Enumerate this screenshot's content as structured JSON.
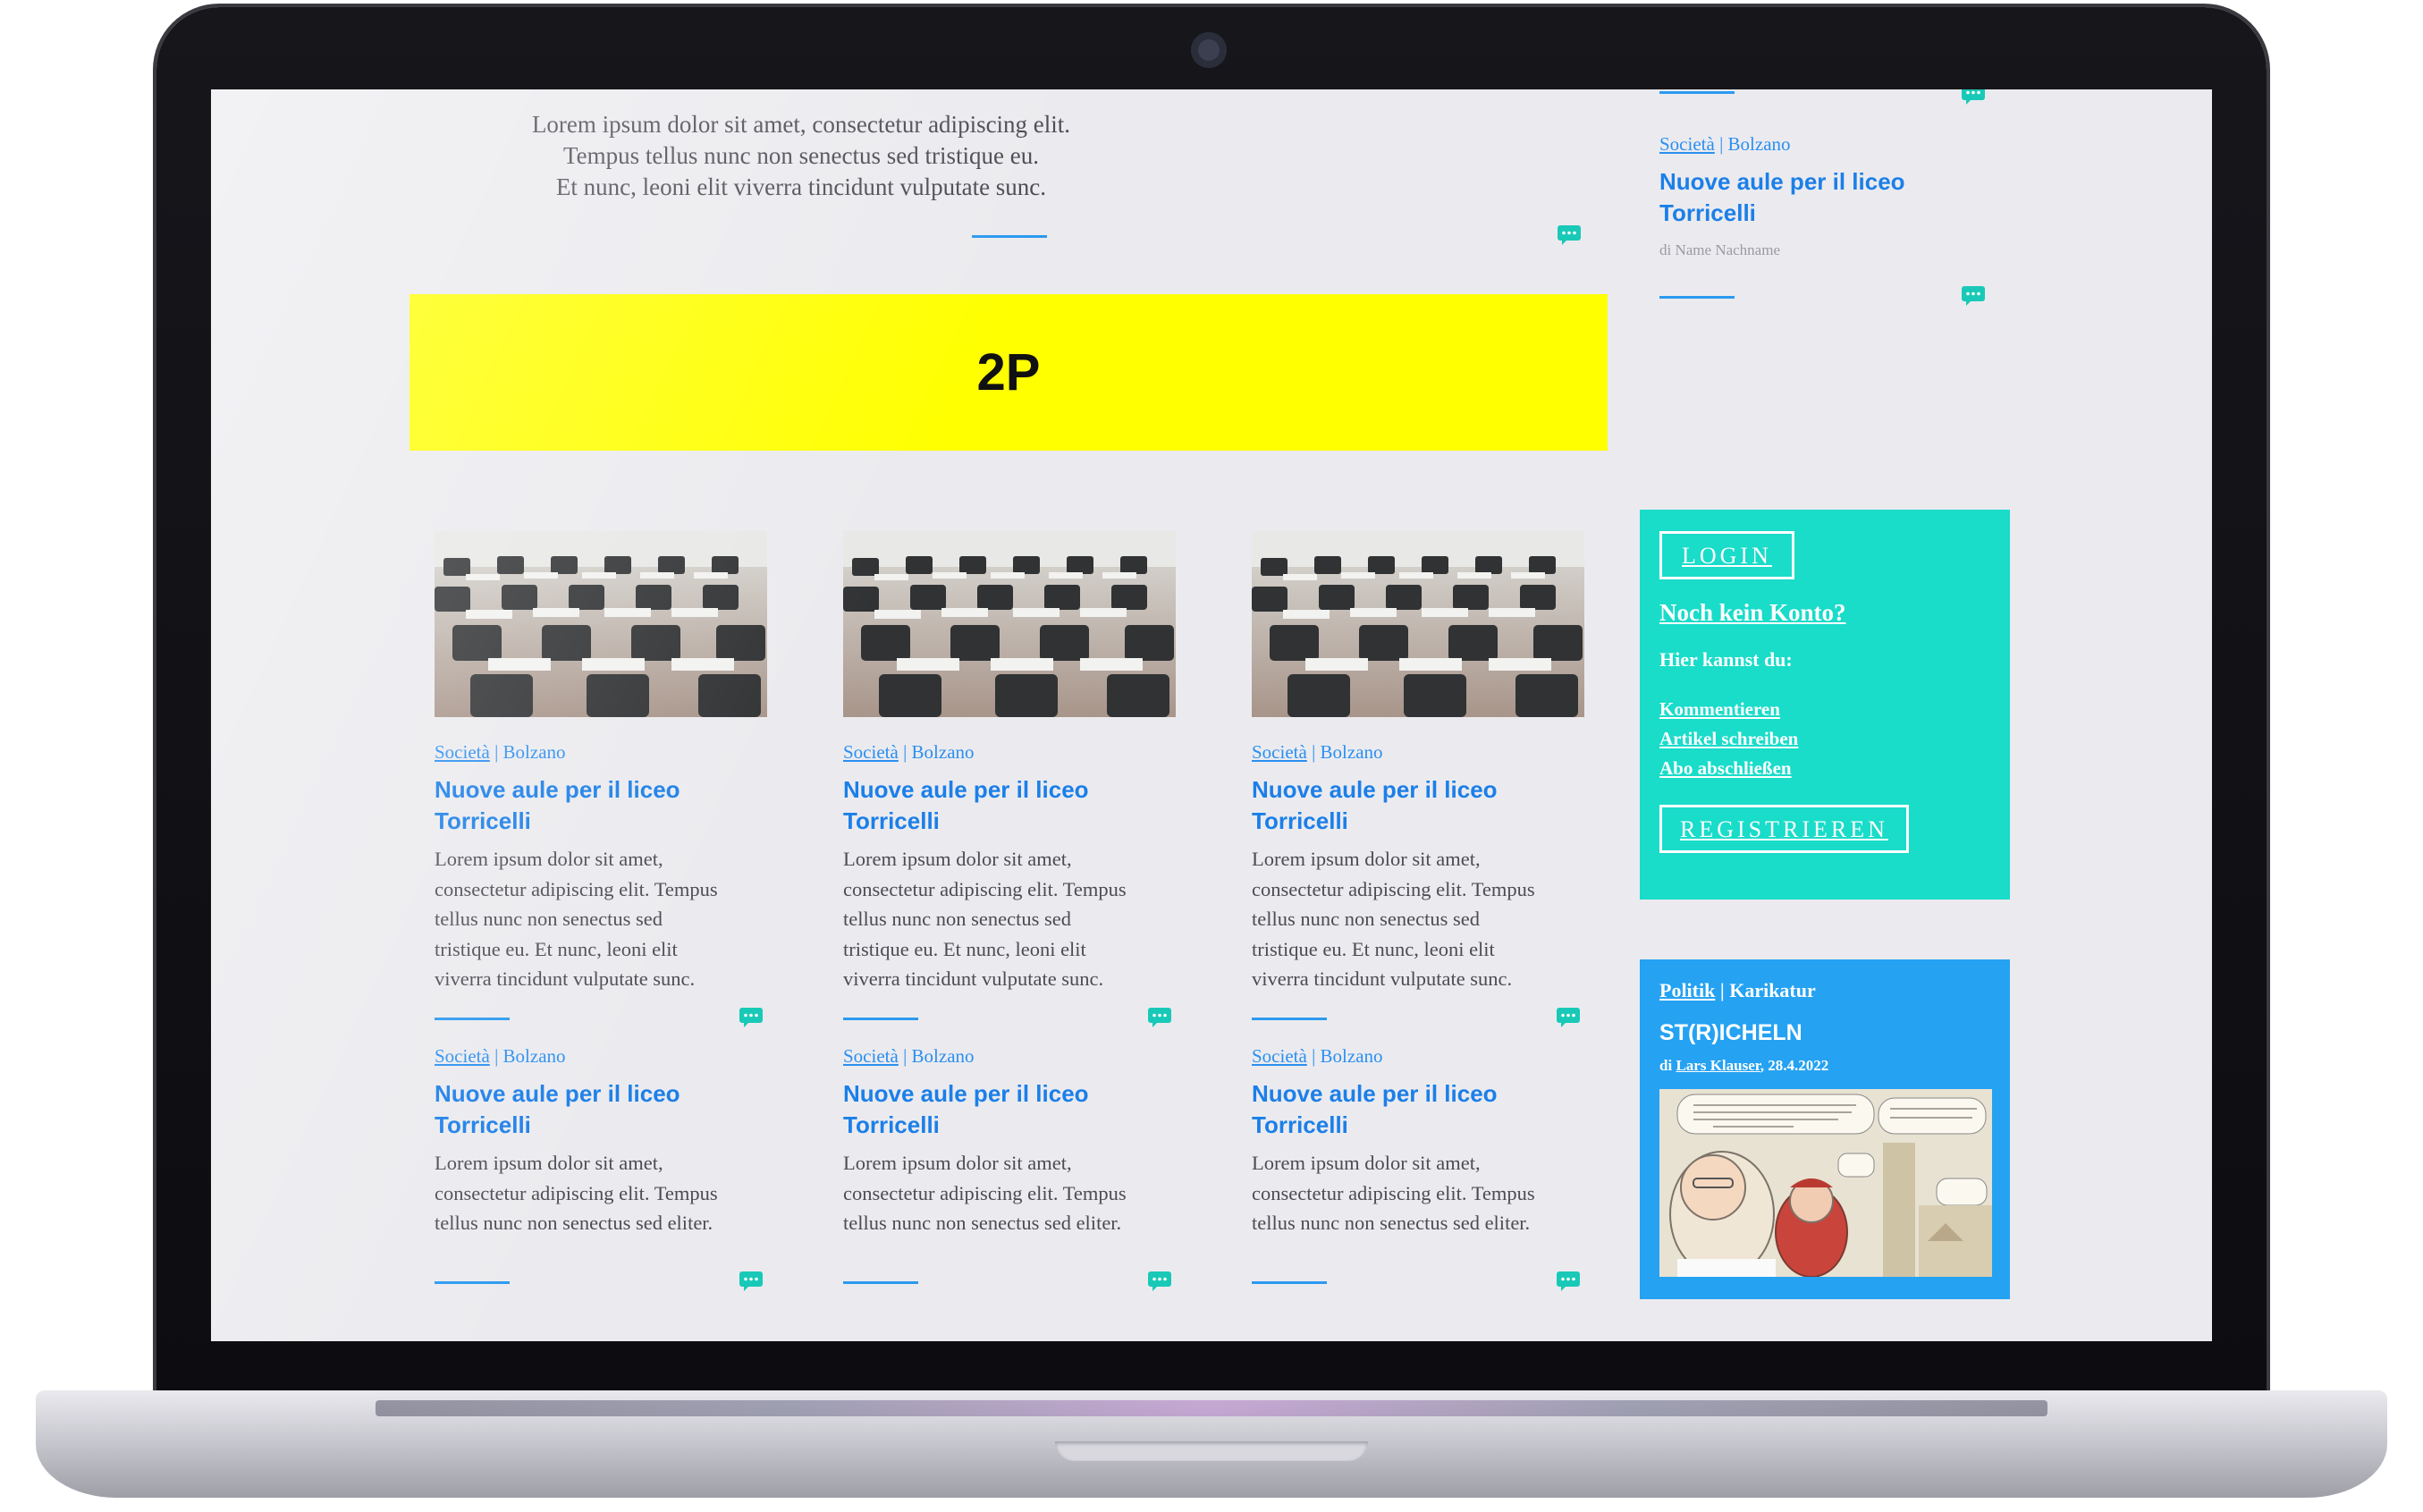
{
  "intro": {
    "lines": [
      "Lorem ipsum dolor sit amet, consectetur adipiscing elit.",
      "Tempus tellus nunc non senectus sed tristique eu.",
      "Et nunc, leoni elit viverra tincidunt vulputate sunc."
    ]
  },
  "ad": {
    "label": "2P"
  },
  "sidebar_top": {
    "category": "Società",
    "location": "Bolzano",
    "separator": " | ",
    "headline_line1": "Nuove aule per il liceo",
    "headline_line2": "Torricelli",
    "byline": "di Name Nachname"
  },
  "cards_top": [
    {
      "category": "Società",
      "separator": " | ",
      "location": "Bolzano",
      "headline_line1": "Nuove aule per il liceo",
      "headline_line2": "Torricelli",
      "body": [
        "Lorem ipsum dolor sit amet,",
        "consectetur adipiscing elit. Tempus",
        "tellus nunc non senectus sed",
        "tristique eu. Et nunc, leoni elit",
        "viverra tincidunt vulputate sunc."
      ]
    },
    {
      "category": "Società",
      "separator": " | ",
      "location": "Bolzano",
      "headline_line1": "Nuove aule per il liceo",
      "headline_line2": "Torricelli",
      "body": [
        "Lorem ipsum dolor sit amet,",
        "consectetur adipiscing elit. Tempus",
        "tellus nunc non senectus sed",
        "tristique eu. Et nunc, leoni elit",
        "viverra tincidunt vulputate sunc."
      ]
    },
    {
      "category": "Società",
      "separator": " | ",
      "location": "Bolzano",
      "headline_line1": "Nuove aule per il liceo",
      "headline_line2": "Torricelli",
      "body": [
        "Lorem ipsum dolor sit amet,",
        "consectetur adipiscing elit. Tempus",
        "tellus nunc non senectus sed",
        "tristique eu. Et nunc, leoni elit",
        "viverra tincidunt vulputate sunc."
      ]
    }
  ],
  "cards_bottom": [
    {
      "category": "Società",
      "separator": " | ",
      "location": "Bolzano",
      "headline_line1": "Nuove aule per il liceo",
      "headline_line2": "Torricelli",
      "body": [
        "Lorem ipsum dolor sit amet,",
        "consectetur adipiscing elit. Tempus",
        "tellus nunc non senectus sed eliter."
      ]
    },
    {
      "category": "Società",
      "separator": " | ",
      "location": "Bolzano",
      "headline_line1": "Nuove aule per il liceo",
      "headline_line2": "Torricelli",
      "body": [
        "Lorem ipsum dolor sit amet,",
        "consectetur adipiscing elit. Tempus",
        "tellus nunc non senectus sed eliter."
      ]
    },
    {
      "category": "Società",
      "separator": " | ",
      "location": "Bolzano",
      "headline_line1": "Nuove aule per il liceo",
      "headline_line2": "Torricelli",
      "body": [
        "Lorem ipsum dolor sit amet,",
        "consectetur adipiscing elit. Tempus",
        "tellus nunc non senectus sed eliter."
      ]
    }
  ],
  "login": {
    "login_label": "LOGIN",
    "no_account": "Noch kein Konto?",
    "can_do": "Hier kannst du:",
    "links": [
      "Kommentieren",
      "Artikel schreiben",
      "Abo abschließen"
    ],
    "register_label": "REGISTRIEREN"
  },
  "cartoon": {
    "category": "Politik",
    "separator": " | ",
    "subcategory": "Karikatur",
    "title": "ST(R)ICHELN",
    "byline_prefix": "di ",
    "author": "Lars Klauser",
    "date": ", 28.4.2022"
  },
  "colors": {
    "accent_blue": "#1c7fe8",
    "teal": "#19dcc9",
    "ad_yellow": "#ffff00",
    "cartoon_blue": "#25a2f2"
  }
}
